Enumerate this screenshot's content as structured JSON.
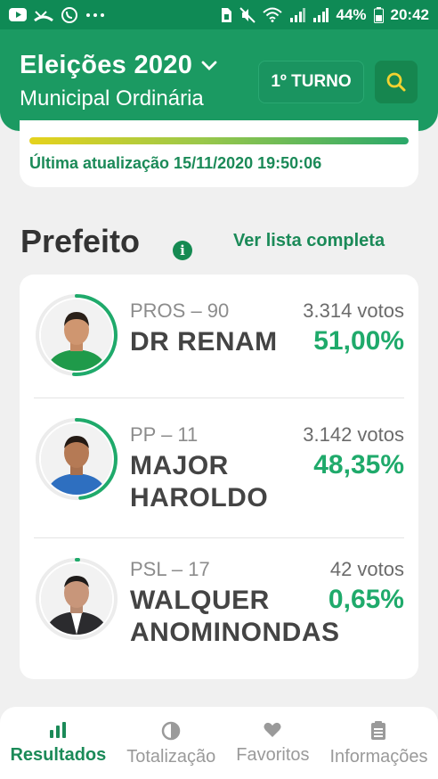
{
  "status_bar": {
    "battery": "44%",
    "time": "20:42",
    "left_icons": [
      "youtube-icon",
      "missed-call-icon",
      "whatsapp-icon",
      "more-dots-icon"
    ],
    "right_icons": [
      "sim-icon",
      "mute-icon",
      "wifi-icon",
      "signal-icon",
      "signal-icon",
      "battery-icon"
    ]
  },
  "header": {
    "title": "Eleições 2020",
    "subtitle": "Municipal Ordinária",
    "turno_label": "1º TURNO",
    "accent": "#1b9a62"
  },
  "update": {
    "label": "Última atualização 15/11/2020 19:50:06",
    "progress": 1.0
  },
  "section": {
    "title": "Prefeito",
    "see_all": "Ver lista completa"
  },
  "candidates": [
    {
      "party": "PROS – 90",
      "name": "DR RENAM",
      "votes": "3.314 votos",
      "percent": "51,00%",
      "share": 0.51
    },
    {
      "party": "PP – 11",
      "name": "MAJOR HAROLDO",
      "votes": "3.142 votos",
      "percent": "48,35%",
      "share": 0.4835
    },
    {
      "party": "PSL – 17",
      "name": "WALQUER ANOMINONDAS",
      "votes": "42 votos",
      "percent": "0,65%",
      "share": 0.0065
    }
  ],
  "bottom_nav": [
    {
      "label": "Resultados",
      "icon": "bar-chart-icon",
      "active": true
    },
    {
      "label": "Totalização",
      "icon": "pie-icon",
      "active": false
    },
    {
      "label": "Favoritos",
      "icon": "heart-icon",
      "active": false
    },
    {
      "label": "Informações",
      "icon": "clipboard-icon",
      "active": false
    }
  ]
}
